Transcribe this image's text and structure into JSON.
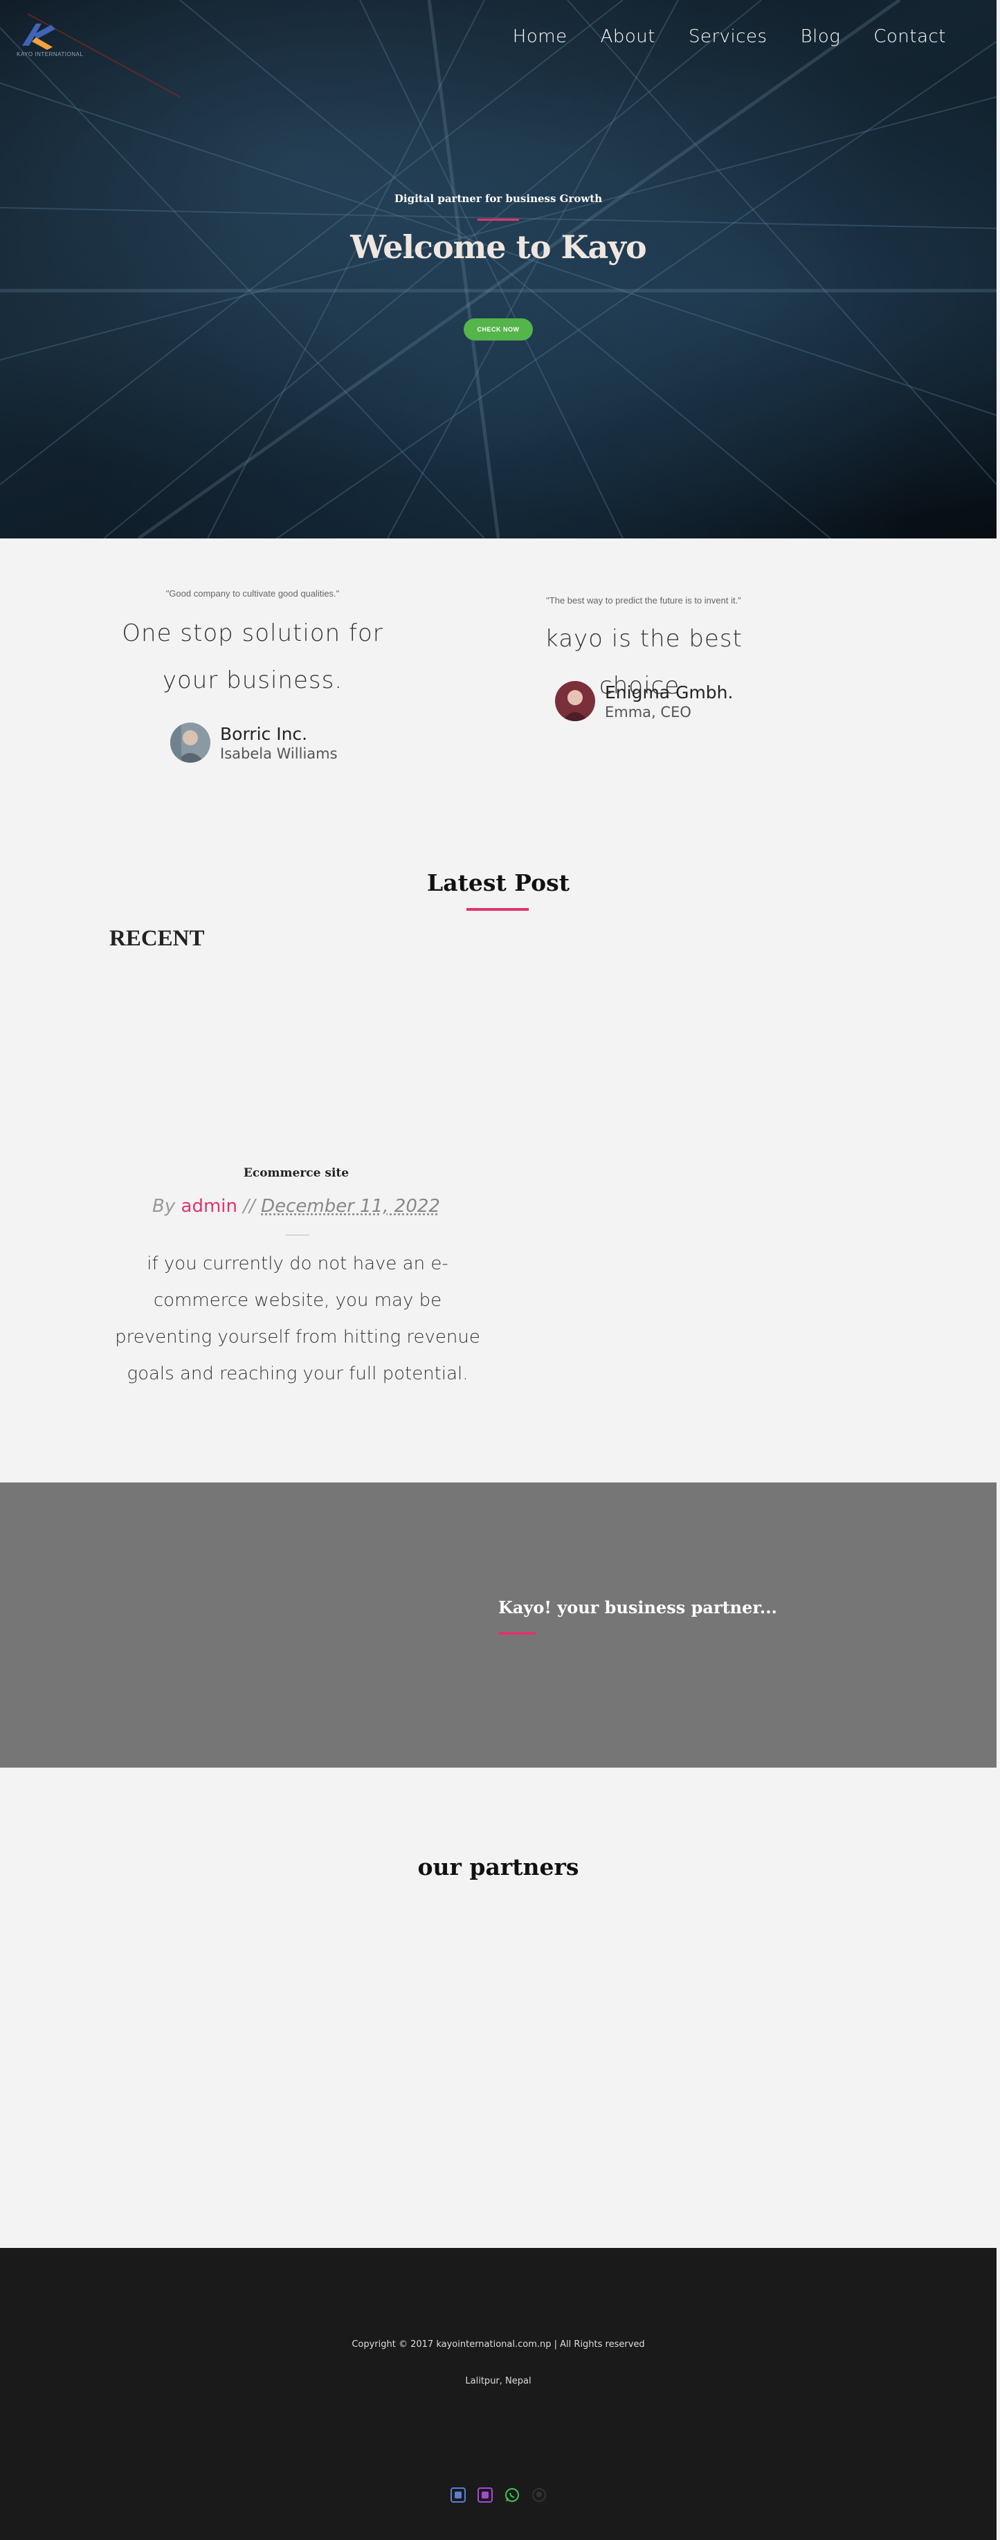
{
  "header": {
    "logo_caption": "KAYO INTERNATIONAL",
    "nav": [
      "Home",
      "About",
      "Services",
      "Blog",
      "Contact"
    ]
  },
  "hero": {
    "tagline": "Digital partner for business Growth",
    "title": "Welcome to Kayo",
    "button": "CHECK NOW"
  },
  "testimonials": [
    {
      "quote": "\"Good company to cultivate good qualities.\"",
      "headline": "One stop solution for your business.",
      "company": "Borric Inc.",
      "person": "Isabela Williams"
    },
    {
      "quote": "\"The best way to predict the future is to invent it.\"",
      "headline": "kayo is the best choice.",
      "company": "Enigma Gmbh.",
      "person": "Emma, CEO"
    }
  ],
  "latest": {
    "title": "Latest Post",
    "recent_label": "RECENT",
    "post": {
      "title": "Ecommerce site",
      "by": "By",
      "author": "admin",
      "separator": "//",
      "date": "December 11, 2022",
      "excerpt": "if you currently do not have an e-commerce website, you may be preventing yourself from hitting revenue goals and reaching your full potential."
    }
  },
  "banner": {
    "title": "Kayo! your business partner..."
  },
  "partners": {
    "title": "our partners"
  },
  "footer": {
    "copyright": "Copyright © 2017 kayointernational.com.np | All Rights reserved",
    "location": "Lalitpur, Nepal"
  },
  "colors": {
    "accent": "#e0336f",
    "button": "#53b54a",
    "footer_bg": "#1a1a1a",
    "banner_bg": "#767676"
  },
  "icons": [
    "kayo-logo-icon",
    "facebook-icon",
    "instagram-icon",
    "whatsapp-icon",
    "github-icon"
  ]
}
